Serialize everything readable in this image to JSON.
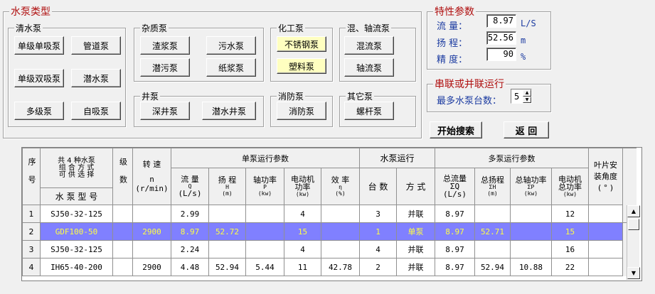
{
  "pump_type": {
    "title": "水泵类型",
    "clean": {
      "title": "清水泵",
      "buttons": [
        "单级单吸泵",
        "管道泵",
        "单级双吸泵",
        "潜水泵",
        "多级泵",
        "自吸泵"
      ]
    },
    "misc": {
      "title": "杂质泵",
      "buttons": [
        "渣浆泵",
        "污水泵",
        "潜污泵",
        "纸浆泵"
      ]
    },
    "chem": {
      "title": "化工泵",
      "buttons": [
        "不锈钢泵",
        "塑料泵"
      ]
    },
    "mixed": {
      "title": "混、轴流泵",
      "buttons": [
        "混流泵",
        "轴流泵"
      ]
    },
    "well": {
      "title": "井泵",
      "buttons": [
        "深井泵",
        "潜水井泵"
      ]
    },
    "fire": {
      "title": "消防泵",
      "buttons": [
        "消防泵"
      ]
    },
    "other": {
      "title": "其它泵",
      "buttons": [
        "螺杆泵"
      ]
    }
  },
  "params": {
    "title": "特性参数",
    "flow": {
      "label": "流  量：",
      "value": "8.97",
      "unit": "L/S"
    },
    "head": {
      "label": "扬  程：",
      "value": "52.56",
      "unit": "m"
    },
    "precision": {
      "label": "精  度：",
      "value": "90",
      "unit": "%"
    }
  },
  "series": {
    "title": "串联或并联运行",
    "label": "最多水泵台数：",
    "value": "5"
  },
  "actions": {
    "search": "开始搜索",
    "back": "返  回"
  },
  "grid": {
    "headers": {
      "seq": "序号",
      "combo": [
        "共 4 种水泵",
        "组 合 方 式",
        "可 供 选 择"
      ],
      "model": "水 泵 型 号",
      "stage": "级数",
      "speed": "转  速",
      "speed_sym": "n",
      "speed_unit": "(r/min)",
      "single_group": "单泵运行参数",
      "single_flow": "流  量",
      "single_flow_sub": [
        "Q",
        "(L/s)"
      ],
      "single_head": "扬  程",
      "single_head_sub": [
        "H",
        "(m)"
      ],
      "single_shaft": "轴功率",
      "single_shaft_sub": [
        "P",
        "(kw)"
      ],
      "single_motor": [
        "电动机",
        "功率"
      ],
      "single_motor_sub": "(kw)",
      "single_eff": "效  率",
      "single_eff_sub": [
        "η",
        "(%)"
      ],
      "run_group": "水泵运行",
      "run_count": "台  数",
      "run_mode": "方  式",
      "multi_group": "多泵运行参数",
      "multi_flow": "总流量",
      "multi_flow_sub": [
        "ΣQ",
        "(L/s)"
      ],
      "multi_head": "总扬程",
      "multi_head_sub": [
        "ΣH",
        "(m)"
      ],
      "multi_shaft": "总轴功率",
      "multi_shaft_sub": [
        "ΣP",
        "(kw)"
      ],
      "multi_motor": [
        "电动机",
        "总功率"
      ],
      "multi_motor_sub": "(kw)",
      "blade": [
        "叶片安",
        "装角度",
        "( ° )"
      ]
    },
    "rows": [
      {
        "no": "1",
        "model": "SJ50-32-125",
        "stage": "",
        "speed": "",
        "q": "2.99",
        "h": "",
        "p": "",
        "motor": "4",
        "eff": "",
        "count": "3",
        "mode": "并联",
        "sq": "8.97",
        "sh": "",
        "sp": "",
        "smotor": "12",
        "blade": ""
      },
      {
        "no": "2",
        "model": "GDF100-50",
        "stage": "",
        "speed": "2900",
        "q": "8.97",
        "h": "52.72",
        "p": "",
        "motor": "15",
        "eff": "",
        "count": "1",
        "mode": "单泵",
        "sq": "8.97",
        "sh": "52.71",
        "sp": "",
        "smotor": "15",
        "blade": ""
      },
      {
        "no": "3",
        "model": "SJ50-32-125",
        "stage": "",
        "speed": "",
        "q": "2.24",
        "h": "",
        "p": "",
        "motor": "4",
        "eff": "",
        "count": "4",
        "mode": "并联",
        "sq": "8.97",
        "sh": "",
        "sp": "",
        "smotor": "16",
        "blade": ""
      },
      {
        "no": "4",
        "model": "IH65-40-200",
        "stage": "",
        "speed": "2900",
        "q": "4.48",
        "h": "52.94",
        "p": "5.44",
        "motor": "11",
        "eff": "42.78",
        "count": "2",
        "mode": "并联",
        "sq": "8.97",
        "sh": "52.94",
        "sp": "10.88",
        "smotor": "22",
        "blade": ""
      }
    ]
  }
}
